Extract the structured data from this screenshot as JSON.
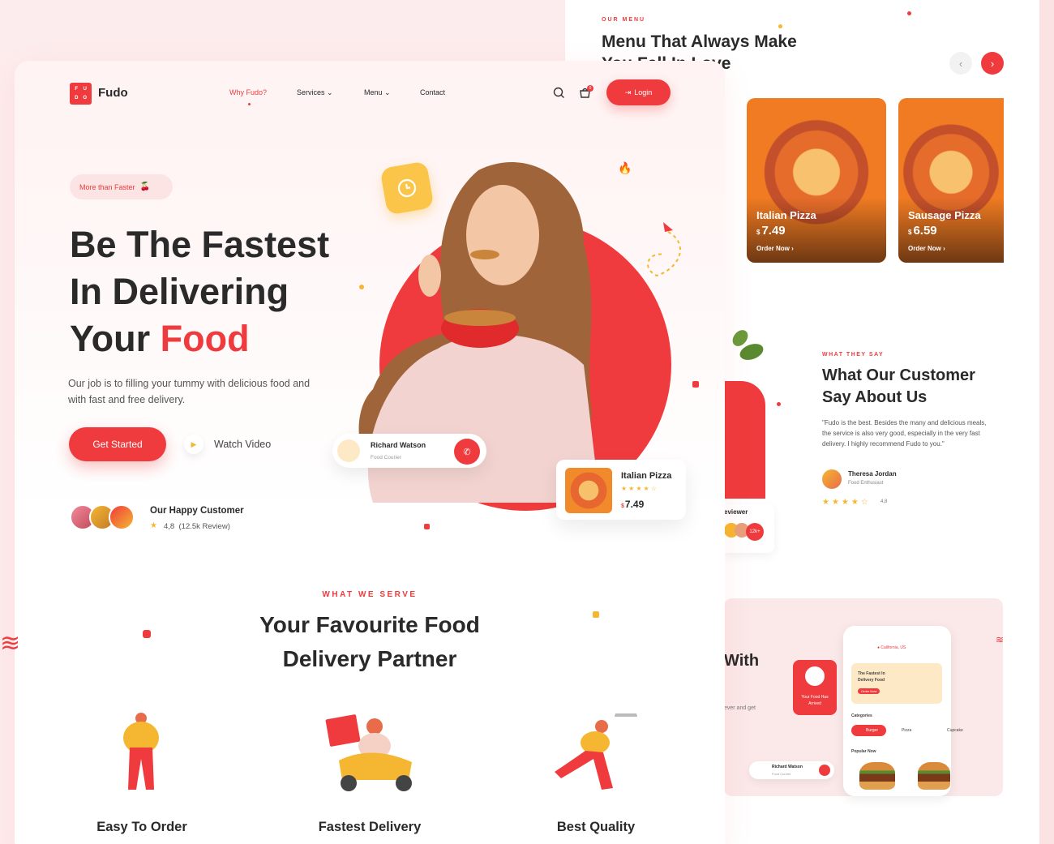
{
  "colors": {
    "accent": "#ef3b3d",
    "yellow": "#f5b731",
    "text": "#2a2a2a",
    "bg": "#fdeced"
  },
  "menu_panel": {
    "eyebrow": "OUR MENU",
    "title": "Menu That Always Make You Fall In Love",
    "prev_icon": "chevron-left-icon",
    "next_icon": "chevron-right-icon",
    "cards": [
      {
        "name": "Italian Pizza",
        "currency": "$",
        "price": "7.49",
        "order": "Order Now"
      },
      {
        "name": "Sausage Pizza",
        "currency": "$",
        "price": "6.59",
        "order": "Order Now"
      }
    ]
  },
  "testimonial": {
    "eyebrow": "WHAT THEY SAY",
    "title": "What Our Customer Say About Us",
    "quote": "\"Fudo is the best. Besides the many and delicious meals, the service is also very good, especially in the very fast delivery. I highly recommend Fudo to you.\"",
    "name": "Theresa Jordan",
    "role": "Food Enthusiast",
    "stars": "★★★★☆",
    "rating": "4,8",
    "reviewer_label": "eviewer",
    "reviewer_count": "12k+"
  },
  "app_preview": {
    "heading_fragment": "With",
    "text_fragment": "ever and get",
    "widget_text": "Your Food Has Arrived",
    "location": "California, US",
    "promo": "The Fastest In Delivery Food",
    "promo_btn": "Order Now",
    "categories_label": "Categories",
    "categories": [
      "Burger",
      "Pizza",
      "Cupcake"
    ],
    "popular_label": "Popular Now",
    "courier_name": "Richard Watson",
    "courier_role": "Food Courier"
  },
  "header": {
    "logo_letters": [
      "F",
      "U",
      "D",
      "O"
    ],
    "brand": "Fudo",
    "nav": [
      {
        "label": "Why Fudo?",
        "active": true
      },
      {
        "label": "Services ⌄"
      },
      {
        "label": "Menu ⌄"
      },
      {
        "label": "Contact"
      }
    ],
    "search_icon": "search-icon",
    "cart_icon": "cart-icon",
    "cart_count": "0",
    "login": "Login"
  },
  "hero": {
    "pill": "More than Faster",
    "title_line1": "Be The Fastest",
    "title_line2": "In Delivering",
    "title_line3_a": "Your ",
    "title_line3_b": "Food",
    "description": "Our job is to filling your tummy with delicious food and with fast and free delivery.",
    "cta": "Get Started",
    "watch": "Watch Video",
    "happy_title": "Our Happy Customer",
    "happy_star": "★",
    "happy_rating": "4,8",
    "happy_reviews": "(12.5k Review)"
  },
  "courier": {
    "name": "Richard Watson",
    "role": "Food Courier"
  },
  "featured": {
    "name": "Italian Pizza",
    "stars": "★★★★☆",
    "currency": "$",
    "price": "7.49"
  },
  "serve": {
    "eyebrow": "WHAT WE SERVE",
    "title_line1": "Your Favourite Food",
    "title_line2": "Delivery Partner",
    "features": [
      "Easy To Order",
      "Fastest Delivery",
      "Best Quality"
    ]
  }
}
